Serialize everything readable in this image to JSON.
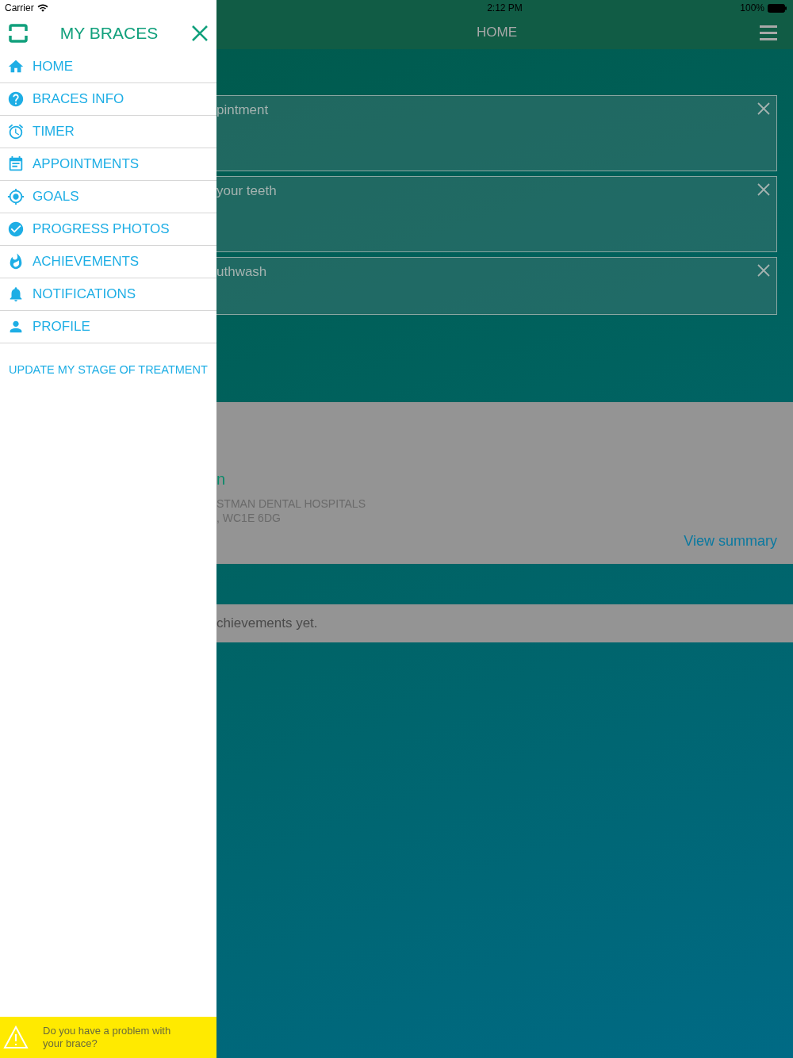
{
  "status_bar": {
    "carrier": "Carrier",
    "time": "2:12 PM",
    "battery": "100%"
  },
  "drawer": {
    "title": "MY BRACES",
    "items": [
      {
        "label": "HOME"
      },
      {
        "label": "BRACES INFO"
      },
      {
        "label": "TIMER"
      },
      {
        "label": "APPOINTMENTS"
      },
      {
        "label": "GOALS"
      },
      {
        "label": "PROGRESS PHOTOS"
      },
      {
        "label": "ACHIEVEMENTS"
      },
      {
        "label": "NOTIFICATIONS"
      },
      {
        "label": "PROFILE"
      }
    ],
    "update_link": "UPDATE MY STAGE OF TREATMENT",
    "problem_banner": "Do you have a problem with your brace?"
  },
  "main": {
    "title": "HOME",
    "reminders": [
      {
        "text": "pintment",
        "tall": true
      },
      {
        "text": "your teeth",
        "tall": true
      },
      {
        "text": "uthwash",
        "tall": false
      }
    ],
    "appointment": {
      "name": "n",
      "address_lines": [
        "STMAN DENTAL HOSPITALS",
        ", WC1E 6DG"
      ],
      "link": "View summary"
    },
    "achievements": "chievements yet."
  }
}
